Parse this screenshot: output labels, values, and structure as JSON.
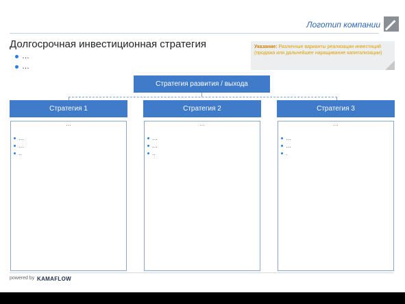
{
  "header": {
    "logo_text": "Логотип компании"
  },
  "slide": {
    "title": "Долгосрочная инвестиционная стратегия",
    "bullets": [
      "…",
      "…"
    ],
    "note_label": "Указание:",
    "note_text": " Различные варианты реализации инвестиций (продажа или дальнейшее наращивание капитализации)",
    "center_box": "Стратегия развития / выхода",
    "columns": [
      {
        "header": "Стратегия 1",
        "top_dots": "…",
        "items": [
          "…",
          "…",
          ".."
        ]
      },
      {
        "header": "Стратегия 2",
        "top_dots": "…",
        "items": [
          "…",
          "…",
          ".."
        ]
      },
      {
        "header": "Стратегия 3",
        "top_dots": "…",
        "items": [
          "…",
          "…",
          "."
        ]
      }
    ]
  },
  "footer": {
    "powered_by": "powered by",
    "brand": "KAMAFLOW"
  },
  "colors": {
    "accent_blue": "#3f7bc8",
    "note_text": "#e0a000",
    "logo_text": "#2b66b4"
  }
}
